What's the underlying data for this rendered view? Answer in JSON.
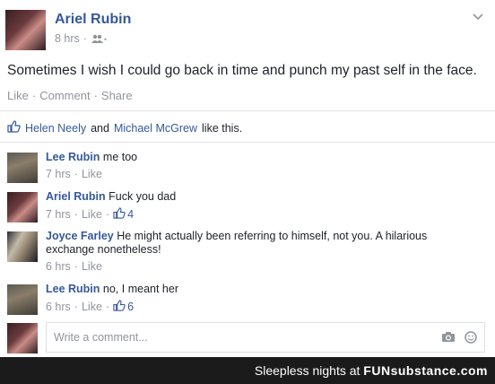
{
  "post": {
    "author": "Ariel Rubin",
    "time": "8 hrs",
    "text": "Sometimes I wish I could go back in time and punch my past self in the face.",
    "actions": {
      "like": "Like",
      "comment": "Comment",
      "share": "Share"
    },
    "likes": {
      "name1": "Helen Neely",
      "and": "and",
      "name2": "Michael McGrew",
      "suffix": "like this."
    }
  },
  "comments": [
    {
      "name": "Lee Rubin",
      "text": "me too",
      "time": "7 hrs",
      "like": "Like",
      "likes": ""
    },
    {
      "name": "Ariel Rubin",
      "text": "Fuck you dad",
      "time": "7 hrs",
      "like": "Like",
      "likes": "4"
    },
    {
      "name": "Joyce Farley",
      "text": "He might actually been referring to himself, not you. A hilarious exchange nonetheless!",
      "time": "6 hrs",
      "like": "Like",
      "likes": ""
    },
    {
      "name": "Lee Rubin",
      "text": "no, I meant her",
      "time": "6 hrs",
      "like": "Like",
      "likes": "6"
    }
  ],
  "write_comment": {
    "placeholder": "Write a comment..."
  },
  "footer": {
    "prefix": "Sleepless nights at ",
    "brand": "FUNsubstance.com"
  },
  "colors": {
    "link": "#365899",
    "meta": "#90949c",
    "text": "#1d2129",
    "footer_bg": "#1b1b1b"
  },
  "icons": [
    "chevron-down-icon",
    "friends-audience-icon",
    "thumbs-up-icon",
    "camera-icon",
    "emoji-icon"
  ]
}
